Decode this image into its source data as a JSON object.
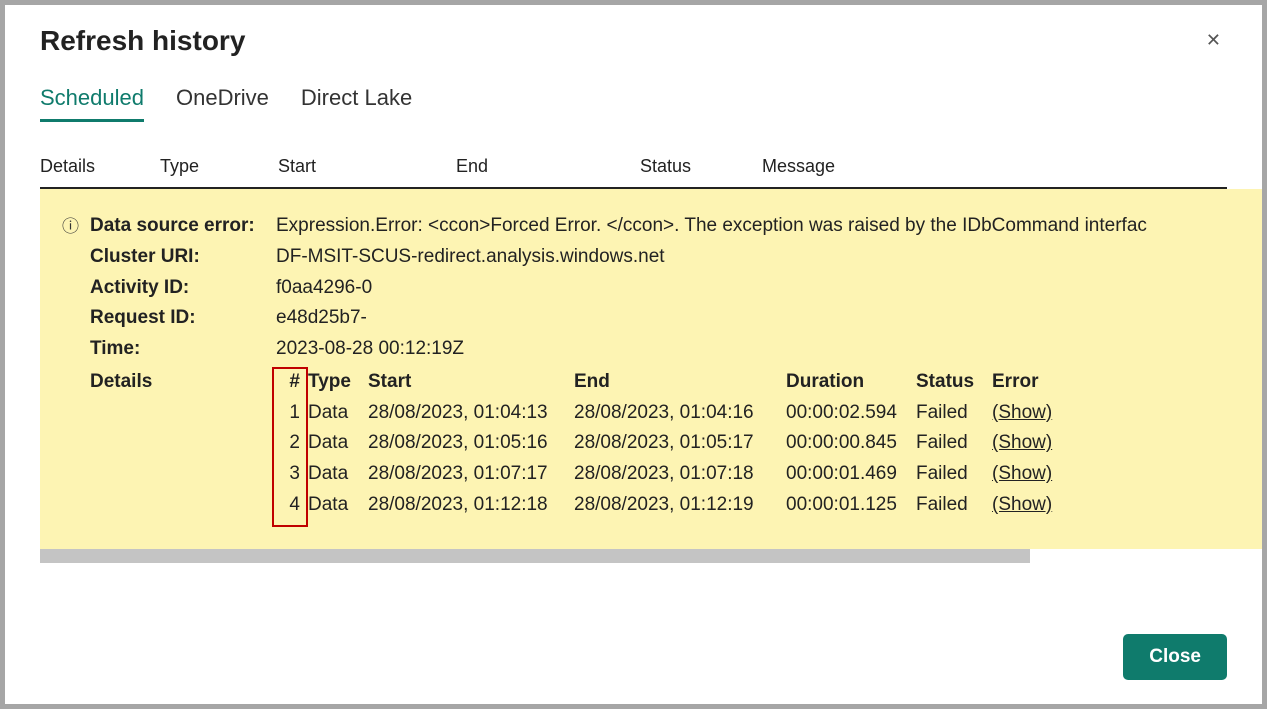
{
  "dialog": {
    "title": "Refresh history",
    "close_button": "Close"
  },
  "tabs": [
    {
      "label": "Scheduled",
      "active": true
    },
    {
      "label": "OneDrive",
      "active": false
    },
    {
      "label": "Direct Lake",
      "active": false
    }
  ],
  "columns": {
    "details": "Details",
    "type": "Type",
    "start": "Start",
    "end": "End",
    "status": "Status",
    "message": "Message"
  },
  "error_panel": {
    "labels": {
      "data_source_error": "Data source error:",
      "cluster_uri": "Cluster URI:",
      "activity_id": "Activity ID:",
      "request_id": "Request ID:",
      "time": "Time:",
      "details": "Details"
    },
    "values": {
      "data_source_error": "Expression.Error: <ccon>Forced Error. </ccon>. The exception was raised by the IDbCommand interfac",
      "cluster_uri": "DF-MSIT-SCUS-redirect.analysis.windows.net",
      "activity_id": "f0aa4296-0",
      "request_id": "e48d25b7-",
      "time": "2023-08-28 00:12:19Z"
    },
    "details_table": {
      "headers": {
        "num": "#",
        "type": "Type",
        "start": "Start",
        "end": "End",
        "duration": "Duration",
        "status": "Status",
        "error": "Error"
      },
      "show_label": "(Show)",
      "rows": [
        {
          "num": "1",
          "type": "Data",
          "start": "28/08/2023, 01:04:13",
          "end": "28/08/2023, 01:04:16",
          "duration": "00:00:02.594",
          "status": "Failed"
        },
        {
          "num": "2",
          "type": "Data",
          "start": "28/08/2023, 01:05:16",
          "end": "28/08/2023, 01:05:17",
          "duration": "00:00:00.845",
          "status": "Failed"
        },
        {
          "num": "3",
          "type": "Data",
          "start": "28/08/2023, 01:07:17",
          "end": "28/08/2023, 01:07:18",
          "duration": "00:00:01.469",
          "status": "Failed"
        },
        {
          "num": "4",
          "type": "Data",
          "start": "28/08/2023, 01:12:18",
          "end": "28/08/2023, 01:12:19",
          "duration": "00:00:01.125",
          "status": "Failed"
        }
      ]
    }
  }
}
